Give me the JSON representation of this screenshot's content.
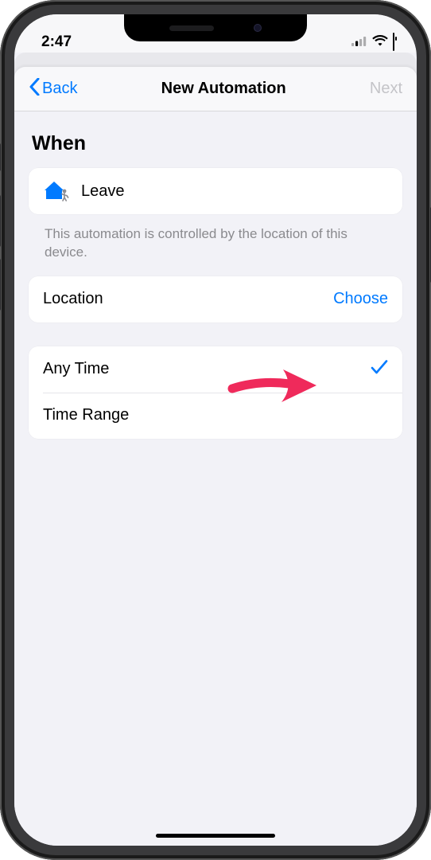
{
  "status": {
    "time": "2:47"
  },
  "nav": {
    "back": "Back",
    "title": "New Automation",
    "next": "Next"
  },
  "section": {
    "title": "When"
  },
  "trigger": {
    "label": "Leave",
    "helper": "This automation is controlled by the location of this device."
  },
  "location": {
    "label": "Location",
    "action": "Choose"
  },
  "time": {
    "options": [
      {
        "label": "Any Time",
        "selected": true
      },
      {
        "label": "Time Range",
        "selected": false
      }
    ]
  },
  "colors": {
    "tint": "#007aff",
    "arrow": "#ef2a5b"
  }
}
